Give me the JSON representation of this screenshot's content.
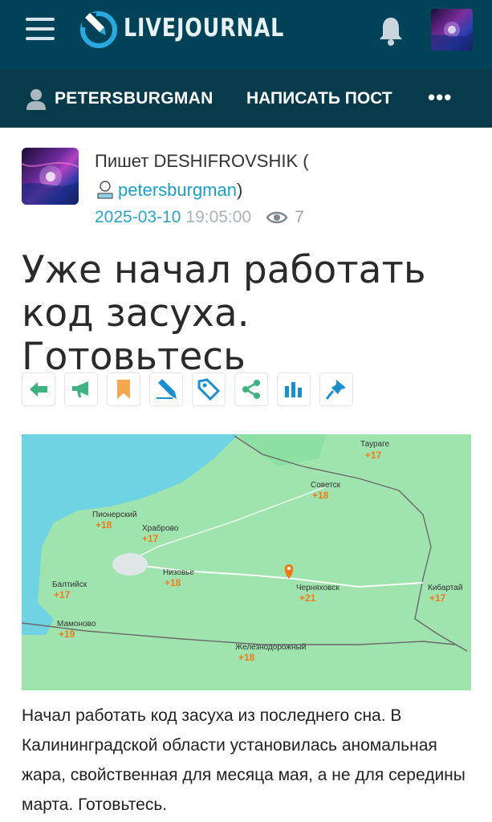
{
  "header": {
    "logo_text": "LIVEJOURNAL",
    "menu_icon": "hamburger-menu-icon",
    "bell_icon": "bell-icon"
  },
  "subnav": {
    "username": "PETERSBURGMAN",
    "write_post": "НАПИСАТЬ ПОСТ",
    "more": "•••"
  },
  "post": {
    "author_prefix": "Пишет DESHIFROVSHIK (",
    "community": "petersburgman",
    "community_suffix": ")",
    "date": "2025-03-10",
    "time": "19:05:00",
    "views": "7",
    "title": "Уже начал работать код засуха. Готовьтесь",
    "body": "Начал работать код засуха из последнего сна. В Калининградской области установилась аномальная жара, свойственная для месяца мая, а не для середины марта. Готовьтесь."
  },
  "actions": [
    {
      "name": "back-arrow-icon",
      "color": "#3fb37f"
    },
    {
      "name": "megaphone-icon",
      "color": "#3fb37f"
    },
    {
      "name": "bookmark-icon",
      "color": "#f5a851"
    },
    {
      "name": "pencil-icon",
      "color": "#1a8fd0"
    },
    {
      "name": "tag-icon",
      "color": "#1a8fd0"
    },
    {
      "name": "share-icon",
      "color": "#3fb37f"
    },
    {
      "name": "stats-icon",
      "color": "#1a8fd0"
    },
    {
      "name": "pin-icon",
      "color": "#1a8fd0"
    }
  ],
  "map": {
    "places": [
      {
        "name": "Таураге",
        "temp": "+17"
      },
      {
        "name": "Советск",
        "temp": "+18"
      },
      {
        "name": "Пионерский",
        "temp": "+18"
      },
      {
        "name": "Храброво",
        "temp": "+17"
      },
      {
        "name": "Низовье",
        "temp": "+18"
      },
      {
        "name": "Черняховск",
        "temp": "+21"
      },
      {
        "name": "Балтийск",
        "temp": "+17"
      },
      {
        "name": "Кибартай",
        "temp": "+17"
      },
      {
        "name": "Мамоново",
        "temp": "+19"
      },
      {
        "name": "Железнодорожный",
        "temp": "+18"
      }
    ]
  }
}
